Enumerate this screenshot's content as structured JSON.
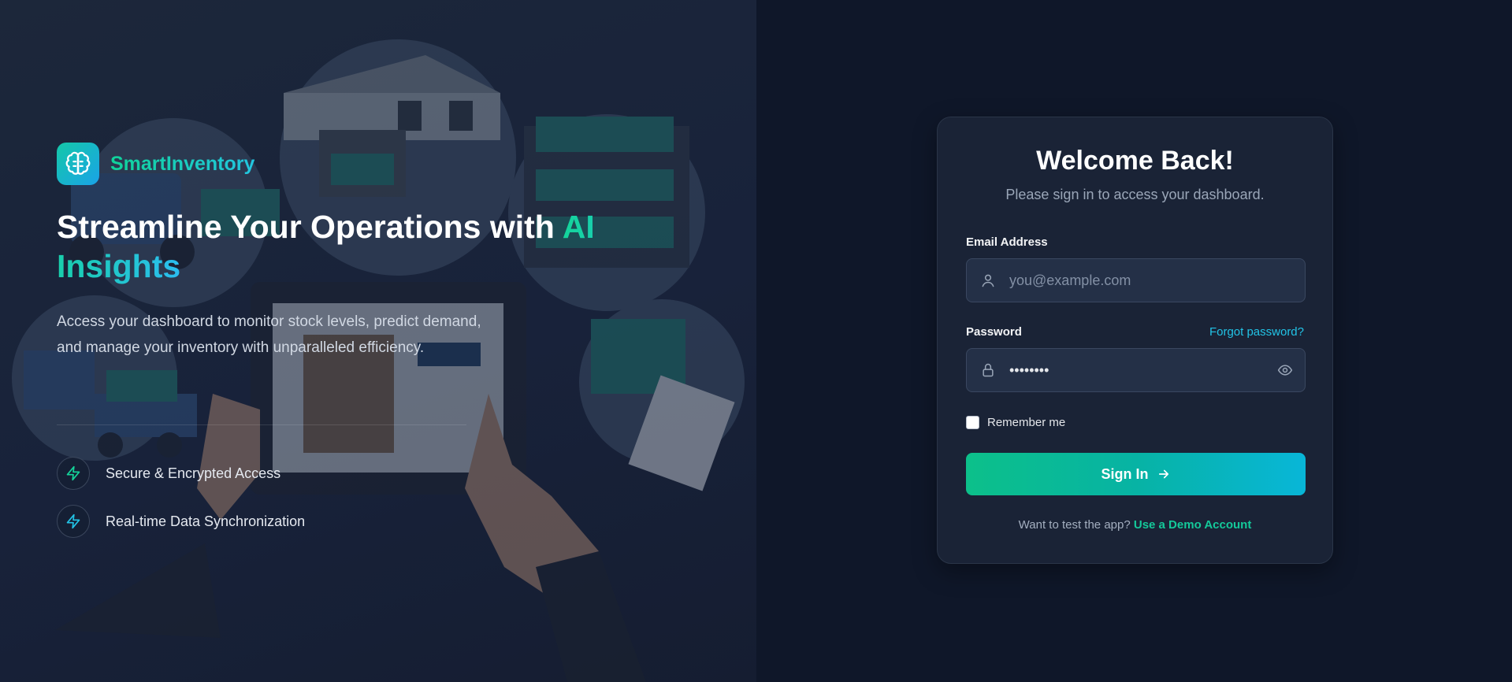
{
  "brand": {
    "name": "SmartInventory",
    "headline_part1": "Streamline Your Operations with ",
    "headline_accent": "AI Insights",
    "description": "Access your dashboard to monitor stock levels, predict demand, and manage your inventory with unparalleled efficiency."
  },
  "features": [
    {
      "label": "Secure & Encrypted Access",
      "icon": "lightning-icon"
    },
    {
      "label": "Real-time Data Synchronization",
      "icon": "lightning-icon"
    }
  ],
  "login": {
    "title": "Welcome Back!",
    "subtitle": "Please sign in to access your dashboard.",
    "email_label": "Email Address",
    "email_placeholder": "you@example.com",
    "password_label": "Password",
    "password_value": "••••••••",
    "forgot_label": "Forgot password?",
    "remember_label": "Remember me",
    "signin_label": "Sign In",
    "demo_prompt": "Want to test the app?",
    "demo_link": "Use a Demo Account"
  },
  "colors": {
    "accent_green": "#14d49a",
    "accent_cyan": "#22c3e6",
    "card_bg": "#1a2336",
    "page_bg": "#0f1729"
  }
}
